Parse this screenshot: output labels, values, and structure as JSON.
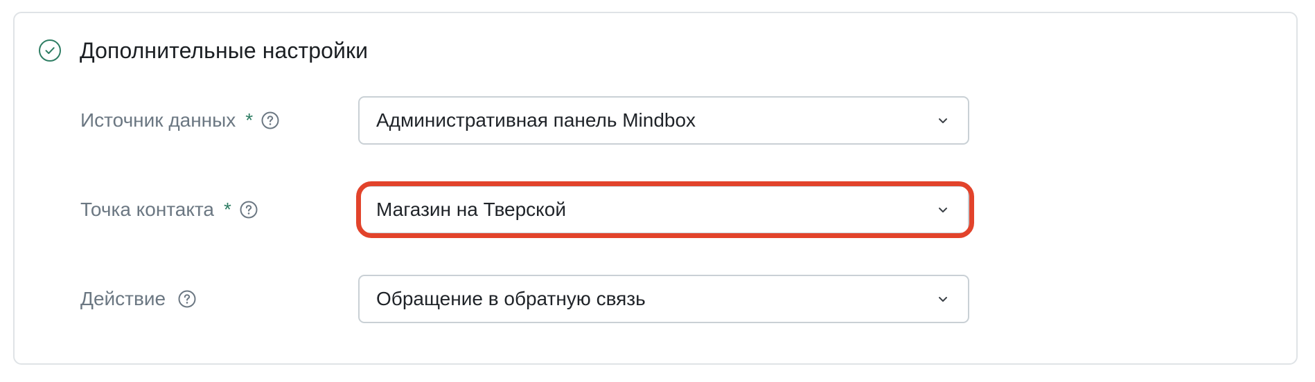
{
  "section": {
    "title": "Дополнительные настройки",
    "status_icon": "check-circle-icon"
  },
  "fields": [
    {
      "label": "Источник данных",
      "required_mark": "*",
      "help_icon": "question-circle-icon",
      "value": "Административная панель Mindbox",
      "dropdown_icon": "chevron-down-icon"
    },
    {
      "label": "Точка контакта",
      "required_mark": "*",
      "help_icon": "question-circle-icon",
      "value": "Магазин на Тверской",
      "dropdown_icon": "chevron-down-icon",
      "highlighted": true
    },
    {
      "label": "Действие",
      "help_icon": "question-circle-icon",
      "value": "Обращение в обратную связь",
      "dropdown_icon": "chevron-down-icon"
    }
  ],
  "colors": {
    "accent_green": "#2e7d63",
    "label_gray": "#6b7782",
    "border": "#c9d0d5",
    "highlight_red": "#e2432b"
  }
}
